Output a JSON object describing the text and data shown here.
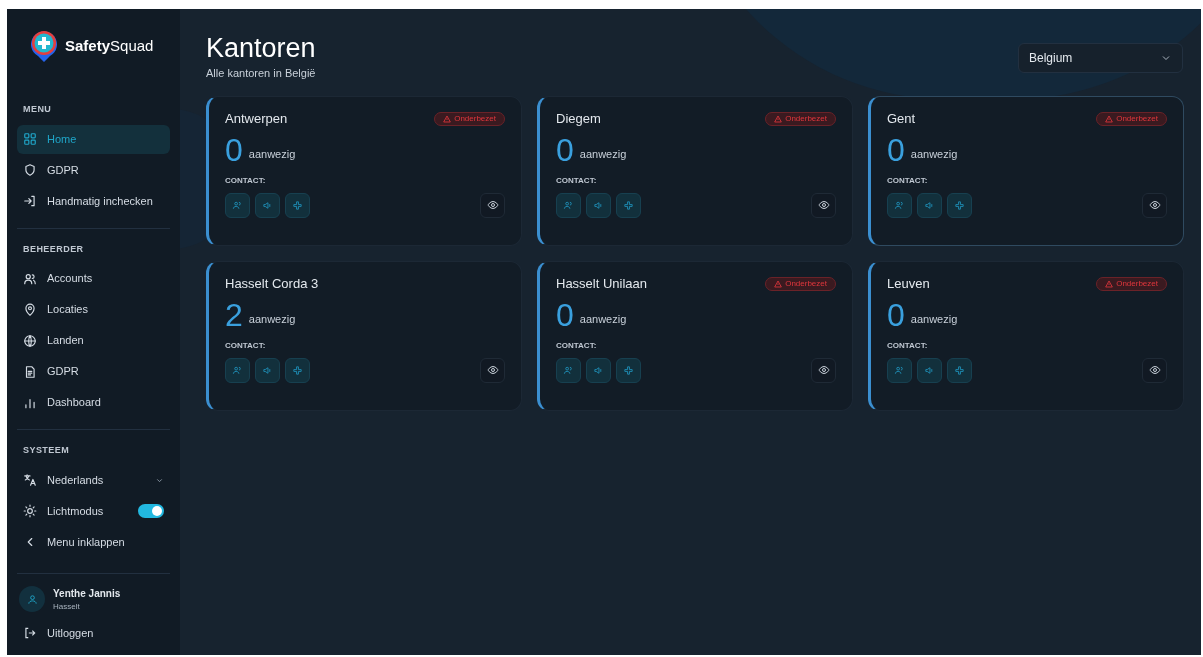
{
  "sidebar": {
    "brand": {
      "first": "Safety",
      "second": "Squad"
    },
    "sections": [
      {
        "heading": "MENU",
        "items": [
          {
            "label": "Home",
            "selected": true
          },
          {
            "label": "GDPR",
            "selected": false
          },
          {
            "label": "Handmatig inchecken",
            "selected": false
          }
        ]
      },
      {
        "heading": "BEHEERDER",
        "items": [
          {
            "label": "Accounts",
            "selected": false
          },
          {
            "label": "Locaties",
            "selected": false
          },
          {
            "label": "Landen",
            "selected": false
          },
          {
            "label": "GDPR",
            "selected": false
          },
          {
            "label": "Dashboard",
            "selected": false
          }
        ]
      },
      {
        "heading": "SYSTEEM",
        "items": [
          {
            "label": "Nederlands",
            "kind": "dropdown",
            "selected": false
          },
          {
            "label": "Lichtmodus",
            "kind": "toggle",
            "on": true,
            "selected": false
          },
          {
            "label": "Menu inklappen",
            "selected": false
          }
        ]
      }
    ],
    "user": {
      "name": "Yenthe Jannis",
      "location": "Hasselt"
    },
    "logout": "Uitloggen"
  },
  "header": {
    "title": "Kantoren",
    "subtitle": "Alle kantoren in België",
    "country": "Belgium"
  },
  "offices": [
    {
      "name": "Antwerpen",
      "count": "0",
      "count_label": "aanwezig",
      "contact_label": "CONTACT:",
      "badge": "Onderbezet",
      "highlighted": false
    },
    {
      "name": "Diegem",
      "count": "0",
      "count_label": "aanwezig",
      "contact_label": "CONTACT:",
      "badge": "Onderbezet",
      "highlighted": false
    },
    {
      "name": "Gent",
      "count": "0",
      "count_label": "aanwezig",
      "contact_label": "CONTACT:",
      "badge": "Onderbezet",
      "highlighted": true
    },
    {
      "name": "Hasselt Corda 3",
      "count": "2",
      "count_label": "aanwezig",
      "contact_label": "CONTACT:",
      "highlighted": false
    },
    {
      "name": "Hasselt Unilaan",
      "count": "0",
      "count_label": "aanwezig",
      "contact_label": "CONTACT:",
      "badge": "Onderbezet",
      "highlighted": false
    },
    {
      "name": "Leuven",
      "count": "0",
      "count_label": "aanwezig",
      "contact_label": "CONTACT:",
      "badge": "Onderbezet",
      "highlighted": false
    }
  ]
}
